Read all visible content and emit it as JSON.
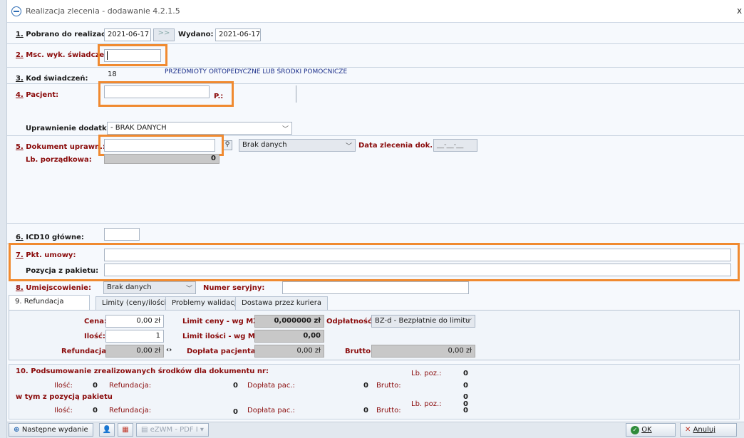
{
  "window": {
    "title": "Realizacja zlecenia - dodawanie 4.2.1.5",
    "close_glyph": "x"
  },
  "row1": {
    "label_num": "1.",
    "label_text": " Pobrano do realizacji:",
    "date_value": "2021-06-17",
    "arrow_button": ">>",
    "issued_label": "Wydano:",
    "issued_value": "2021-06-17"
  },
  "row2": {
    "label_num": "2.",
    "label_text": " Msc. wyk. świadczeń:",
    "value": ""
  },
  "row3": {
    "label_num": "3.",
    "label_text": " Kod świadczeń:",
    "value": "18",
    "description": "PRZEDMIOTY ORTOPEDYCZNE LUB ŚRODKI POMOCNICZE"
  },
  "row4": {
    "label_num": "4.",
    "label_text": " Pacjent:",
    "value": "",
    "p_label": "P.:"
  },
  "uprawnienie": {
    "label": "Uprawnienie dodatk.:",
    "value": "- BRAK DANYCH"
  },
  "row5": {
    "label_num": "5.",
    "label_text": " Dokument uprawn.:",
    "value": "",
    "combo_value": "Brak danych",
    "date_label": "Data zlecenia dok.:",
    "date_value": "__-__-__"
  },
  "lp": {
    "label": "Lb. porządkowa:",
    "value": "0"
  },
  "row6": {
    "label_num": "6.",
    "label_text": " ICD10 główne:",
    "value": ""
  },
  "row7": {
    "label_num": "7.",
    "label_text": " Pkt. umowy:",
    "value": "",
    "pakiet_label": "Pozycja z pakietu:",
    "pakiet_value": ""
  },
  "row8": {
    "label_num": "8.",
    "label_text": " Umiejscowienie:",
    "combo_value": "Brak danych",
    "serial_label": "Numer seryjny:",
    "serial_value": ""
  },
  "tabs": [
    {
      "label": "9. Refundacja"
    },
    {
      "label": "Limity (ceny/ilości)"
    },
    {
      "label": "Problemy walidacji"
    },
    {
      "label": "Dostawa przez kuriera"
    }
  ],
  "refundacja": {
    "cena_label": "Cena:",
    "cena_value": "0,00 zł",
    "limit_ceny_label": "Limit ceny - wg MZ:",
    "limit_ceny_value": "0,000000 zł",
    "odplatnosc_label": "Odpłatność:",
    "odplatnosc_value": "BZ-d - Bezpłatnie do limitu",
    "ilosc_label": "Ilość:",
    "ilosc_value": "1",
    "limit_ilosci_label": "Limit ilości - wg MZ:",
    "limit_ilosci_value": "0,00",
    "refundacja_label": "Refundacja:",
    "refundacja_value": "0,00 zł",
    "swap_glyph": "‹›",
    "doplata_label": "Dopłata pacjenta:",
    "doplata_value": "0,00 zł",
    "brutto_label": "Brutto:",
    "brutto_value": "0,00 zł"
  },
  "summary": {
    "title": "10. Podsumowanie zrealizowanych środków dla dokumentu nr:",
    "ilosc_label": "Ilość:",
    "ilosc_value": "0",
    "refundacja_label": "Refundacja:",
    "refundacja_value": "0",
    "doplata_label": "Dopłata pac.:",
    "doplata_value": "0",
    "brutto_label": "Brutto:",
    "brutto_value": "0",
    "lbpoz_label": "Lb. poz.:",
    "lbpoz_value": "0",
    "pakiet_title": "w tym z pozycją pakietu",
    "p_lbpoz_label": "Lb. poz.:",
    "p_lbpoz_value": "0",
    "p_brutto_top_value": "0",
    "p_ilosc_label": "Ilość:",
    "p_ilosc_value": "0",
    "p_refundacja_label": "Refundacja:",
    "p_refundacja_value": "0",
    "p_doplata_label": "Dopłata pac.:",
    "p_doplata_value": "0",
    "p_brutto_label": "Brutto:",
    "p_brutto_value": "0"
  },
  "bottom": {
    "next_label": "Następne wydanie",
    "ezwm_label": "eZWM - PDF I",
    "ok_label": "OK",
    "cancel_label": "Anuluj"
  },
  "colors": {
    "highlight": "#f08a30",
    "label_red": "#8a0b0b",
    "accent": "#2f6db5"
  }
}
